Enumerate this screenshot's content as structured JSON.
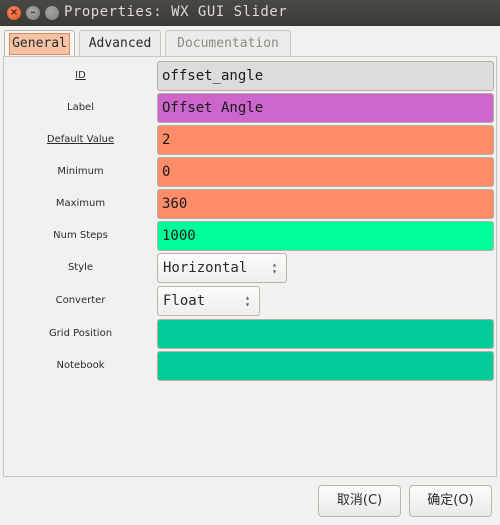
{
  "window": {
    "title": "Properties: WX GUI Slider",
    "controls": {
      "close_glyph": "×",
      "minimize_glyph": "–",
      "maximize_glyph": ""
    }
  },
  "tabs": [
    {
      "label": "General",
      "active": true
    },
    {
      "label": "Advanced",
      "active": false
    },
    {
      "label": "Documentation",
      "active": false
    }
  ],
  "fields": {
    "id": {
      "label": "ID",
      "value": "offset_angle",
      "color": "#dcdcdc"
    },
    "label": {
      "label": "Label",
      "value": "Offset Angle",
      "color": "#cc66cc"
    },
    "default_value": {
      "label": "Default Value",
      "value": "2",
      "color": "#ff8c69"
    },
    "minimum": {
      "label": "Minimum",
      "value": "0",
      "color": "#ff8c69"
    },
    "maximum": {
      "label": "Maximum",
      "value": "360",
      "color": "#ff8c69"
    },
    "num_steps": {
      "label": "Num Steps",
      "value": "1000",
      "color": "#00ff99"
    },
    "style": {
      "label": "Style",
      "value": "Horizontal"
    },
    "converter": {
      "label": "Converter",
      "value": "Float"
    },
    "grid_position": {
      "label": "Grid Position",
      "value": "",
      "color": "#00cc99"
    },
    "notebook": {
      "label": "Notebook",
      "value": "",
      "color": "#00cc99"
    }
  },
  "buttons": {
    "cancel": "取消(C)",
    "ok": "确定(O)"
  }
}
